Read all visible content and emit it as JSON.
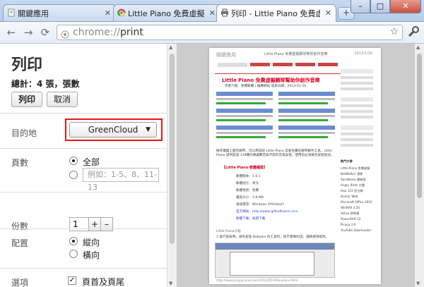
{
  "tabs": [
    {
      "label": "關鍵應用",
      "icon": "document-icon"
    },
    {
      "label": "Little Piano 免費虛擬鋼琴",
      "icon": "chrome-icon"
    },
    {
      "label": "列印 - Little Piano 免費虛擬",
      "icon": "printer-icon"
    }
  ],
  "toolbar": {
    "url_scheme": "chrome://",
    "url_path": "print"
  },
  "print": {
    "title": "列印",
    "summary": "總計：4 張，張數",
    "print_label": "列印",
    "cancel_label": "取消",
    "destination_label": "目的地",
    "destination_value": "GreenCloud",
    "pages_label": "頁數",
    "pages_all_label": "全部",
    "pages_placeholder": "例如：1-5、8、11-13",
    "copies_label": "份數",
    "copies_value": "1",
    "copies_plus": "+",
    "copies_minus": "–",
    "layout_label": "配置",
    "layout_portrait": "縱向",
    "layout_landscape": "橫向",
    "options_label": "選項",
    "options_header_footer": "頁首及頁尾"
  },
  "preview": {
    "header_left": "關鍵應用",
    "header_center": "Little Piano 免費虛擬鋼琴幫你創作音樂",
    "header_right": "2013/1/26",
    "article_title": "Little Piano 免費虛擬鋼琴幫助你創作音樂",
    "byline": "作者介紹：免費軟體 | 推薦網站 發表日期：2013-01-26",
    "intro": "擁有電腦上面有鋼琴，可以用說說 Little Piano 這套免費的鋼琴軟件工具，Little Piano 提供超過 128種的樂器聲音與不錯的音質表現，使用前必須要先安裝程式。",
    "info_header": "【Little Piano 軟體檔案】",
    "info_rows": [
      "軟體版本：1.0.1",
      "軟體語言：英文",
      "軟體性質：免費",
      "檔案大小：2.8 MB",
      "系統需求：Windows XP/Vista/7",
      "官方網站：http://www.gilfsoftware.com",
      "軟體下載：按我下載"
    ],
    "section_title": "Little Piano介紹",
    "section_text": "1.進行安裝時，請先安裝 Babylon 的工具列，如不需要的話，請將選項取消。",
    "sidebar_heading": "熱門文章",
    "sidebar_items": [
      "Little Piano 免費虛擬",
      "NetWalker 漂移",
      "Sandboxie 最新版",
      "Angry Birds 主題",
      "Hao 123 官方網",
      "Doctor Web",
      "Microsoft Office 2010",
      "WinRAR 4.20",
      "Yahoo 即時通",
      "PowerDVD 12",
      "Picasa 3.9",
      "YouTube Downloader"
    ],
    "footer": "http://www.playpcesor.com/2013/01/little-piano.html"
  }
}
